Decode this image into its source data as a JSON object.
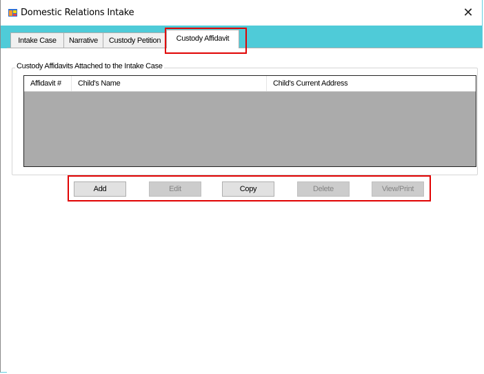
{
  "window": {
    "title": "Domestic Relations Intake",
    "close_glyph": "✕",
    "accent_color": "#4fcbd8"
  },
  "tabs": [
    {
      "label": "Intake Case",
      "active": false
    },
    {
      "label": "Narrative",
      "active": false
    },
    {
      "label": "Custody Petition",
      "active": false
    },
    {
      "label": "Custody Affidavit",
      "active": true
    }
  ],
  "groupbox": {
    "label": "Custody Affidavits Attached to the Intake Case"
  },
  "grid": {
    "columns": [
      "Affidavit #",
      "Child's Name",
      "Child's Current Address"
    ],
    "rows": []
  },
  "buttons": [
    {
      "label": "Add",
      "enabled": true
    },
    {
      "label": "Edit",
      "enabled": false
    },
    {
      "label": "Copy",
      "enabled": true
    },
    {
      "label": "Delete",
      "enabled": false
    },
    {
      "label": "View/Print",
      "enabled": false
    }
  ],
  "annotation_color": "#e00000"
}
